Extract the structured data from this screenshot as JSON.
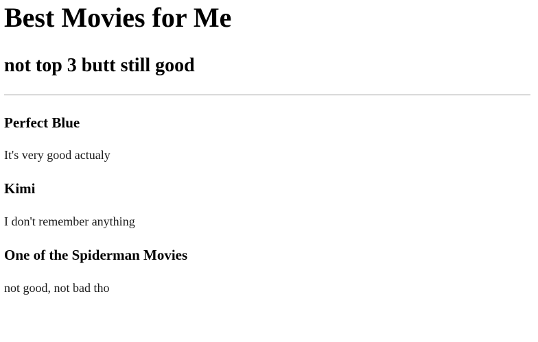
{
  "page": {
    "title": "Best Movies for Me",
    "subtitle": "not top 3 butt still good"
  },
  "movies": [
    {
      "title": "Perfect Blue",
      "description": "It's very good actualy"
    },
    {
      "title": "Kimi",
      "description": "I don't remember anything"
    },
    {
      "title": "One of the Spiderman Movies",
      "description": "not good, not bad tho"
    }
  ]
}
